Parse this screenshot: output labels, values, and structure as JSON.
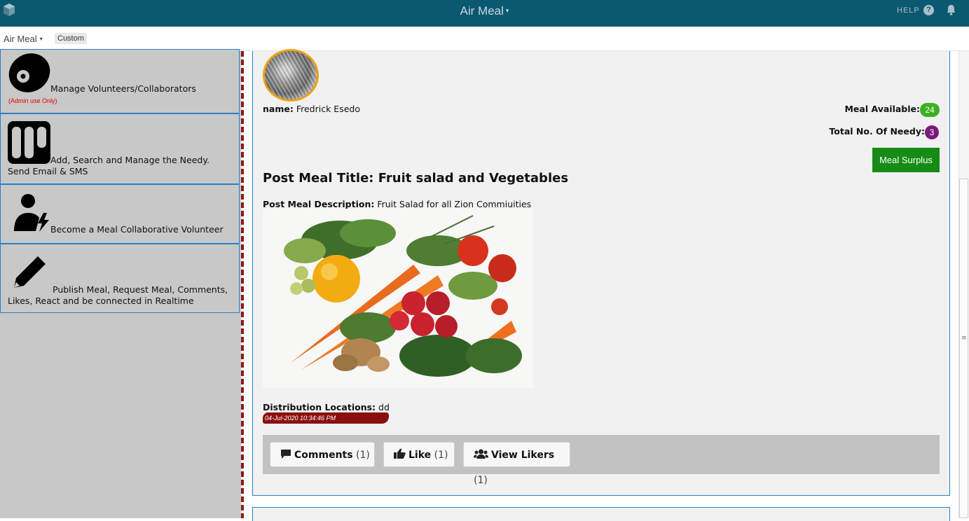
{
  "topbar": {
    "app_title": "Air Meal",
    "caret": "▾",
    "help_label": "HELP",
    "help_icon": "?"
  },
  "subbar": {
    "app_name": "Air Meal",
    "caret": "▾",
    "view_tag": "Custom"
  },
  "sidebar": {
    "items": [
      {
        "label": "Manage Volunteers/Collaborators",
        "icon": "record-icon"
      },
      {
        "label": "Add, Search and Manage the Needy. Send Email & SMS",
        "icon": "columns-icon"
      },
      {
        "label": "Become a Meal Collaborative Volunteer",
        "icon": "user-bolt-icon"
      },
      {
        "label": "Publish Meal, Request Meal, Comments, Likes, React and be connected in Realtime",
        "icon": "pencil-icon"
      }
    ],
    "admin_note": "(Admin use Only)"
  },
  "post": {
    "name_label": "name:",
    "name_value": "Fredrick Esedo",
    "meal_available_label": "Meal Available:",
    "meal_available_count": "24",
    "needy_label": "Total No. Of Needy:",
    "needy_count": "3",
    "surplus_button": "Meal Surplus",
    "title": "Post Meal Title: Fruit salad and Vegetables",
    "description_label": "Post Meal Description:",
    "description_value": "Fruit Salad for all Zion Commiuities",
    "distribution_label": "Distribution Locations:",
    "distribution_value": "dd",
    "timestamp": "04-Jul-2020 10:34:46 PM"
  },
  "actions": {
    "comments_label": "Comments",
    "comments_count": "(1)",
    "like_label": "Like",
    "like_count": "(1)",
    "likers_label": "View Likers",
    "likers_count": "(1)"
  },
  "scrollbar": {
    "grip": "≡"
  },
  "colors": {
    "topbar": "#0b5871",
    "sidebar": "#c8c8c8",
    "accent_border": "#2a7fc6",
    "meal_badge": "#3cb021",
    "needy_badge": "#7a1a7a",
    "surplus_button": "#168c16",
    "timestamp_bg": "#8b0f0f"
  }
}
